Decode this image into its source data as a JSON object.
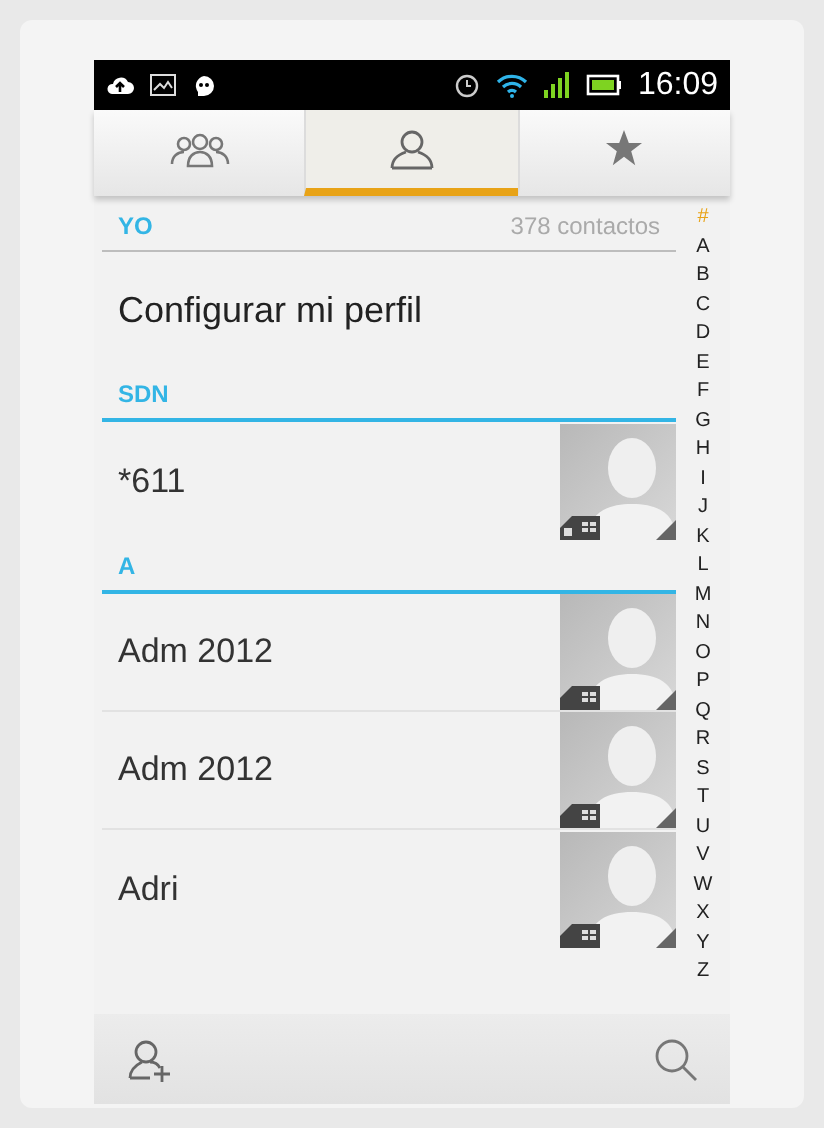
{
  "status_bar": {
    "time": "16:09"
  },
  "tabs": [
    {
      "kind": "group",
      "selected": false
    },
    {
      "kind": "person",
      "selected": true
    },
    {
      "kind": "star",
      "selected": false
    }
  ],
  "sections": [
    {
      "header": "YO",
      "count": "378 contactos",
      "accent": false,
      "rows": [
        {
          "kind": "action",
          "name": "Configurar mi perfil"
        }
      ]
    },
    {
      "header": "SDN",
      "accent": true,
      "rows": [
        {
          "kind": "contact",
          "name": "*611",
          "locked": true
        }
      ]
    },
    {
      "header": "A",
      "accent": true,
      "rows": [
        {
          "kind": "contact",
          "name": "Adm 2012",
          "locked": false
        },
        {
          "kind": "contact",
          "name": "Adm 2012",
          "locked": false
        },
        {
          "kind": "contact",
          "name": "Adri",
          "locked": false
        }
      ]
    }
  ],
  "index": [
    {
      "label": "#",
      "selected": true
    },
    {
      "label": "A",
      "selected": false
    },
    {
      "label": "B",
      "selected": false
    },
    {
      "label": "C",
      "selected": false
    },
    {
      "label": "D",
      "selected": false
    },
    {
      "label": "E",
      "selected": false
    },
    {
      "label": "F",
      "selected": false
    },
    {
      "label": "G",
      "selected": false
    },
    {
      "label": "H",
      "selected": false
    },
    {
      "label": "I",
      "selected": false
    },
    {
      "label": "J",
      "selected": false
    },
    {
      "label": "K",
      "selected": false
    },
    {
      "label": "L",
      "selected": false
    },
    {
      "label": "M",
      "selected": false
    },
    {
      "label": "N",
      "selected": false
    },
    {
      "label": "O",
      "selected": false
    },
    {
      "label": "P",
      "selected": false
    },
    {
      "label": "Q",
      "selected": false
    },
    {
      "label": "R",
      "selected": false
    },
    {
      "label": "S",
      "selected": false
    },
    {
      "label": "T",
      "selected": false
    },
    {
      "label": "U",
      "selected": false
    },
    {
      "label": "V",
      "selected": false
    },
    {
      "label": "W",
      "selected": false
    },
    {
      "label": "X",
      "selected": false
    },
    {
      "label": "Y",
      "selected": false
    },
    {
      "label": "Z",
      "selected": false
    }
  ]
}
